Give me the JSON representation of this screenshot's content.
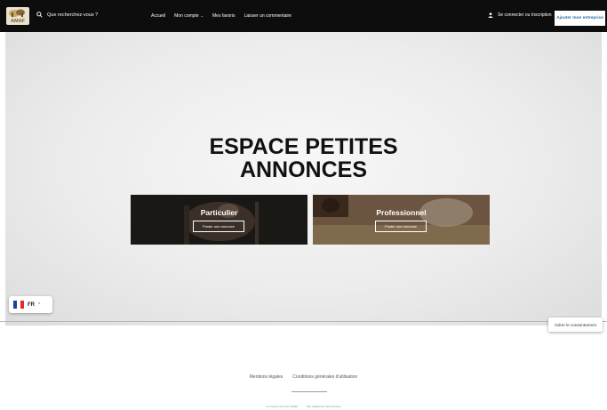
{
  "header": {
    "logo_text": "AMAF",
    "search_label": "Que recherchez-vous ?",
    "nav": [
      {
        "label": "Accueil"
      },
      {
        "label": "Mon compte"
      },
      {
        "label": "Mes favoris"
      },
      {
        "label": "Laisser un commentaire"
      }
    ],
    "login_label": "Se connecter ou Inscription",
    "add_business_label": "Ajouter mon entreprise"
  },
  "hero": {
    "title_line1": "ESPACE PETITES",
    "title_line2": "ANNONCES",
    "cards": [
      {
        "title": "Particulier",
        "button": "Poster une annonce"
      },
      {
        "title": "Professionnel",
        "button": "Poster une annonce"
      }
    ]
  },
  "language": {
    "code": "FR",
    "flag_colors": [
      "#1f3f9a",
      "#ffffff",
      "#e3262f"
    ]
  },
  "consent_label": "Gérer le consentement",
  "footer": {
    "links": [
      "Mentions légales",
      "Conditions générales d'utilisation"
    ],
    "copyright": "La maison au feruo ©2023",
    "credit": "Site réalisé par Tarin Promes"
  },
  "colors": {
    "navbar": "#0d0d0d",
    "accent": "#2c6ea6"
  }
}
